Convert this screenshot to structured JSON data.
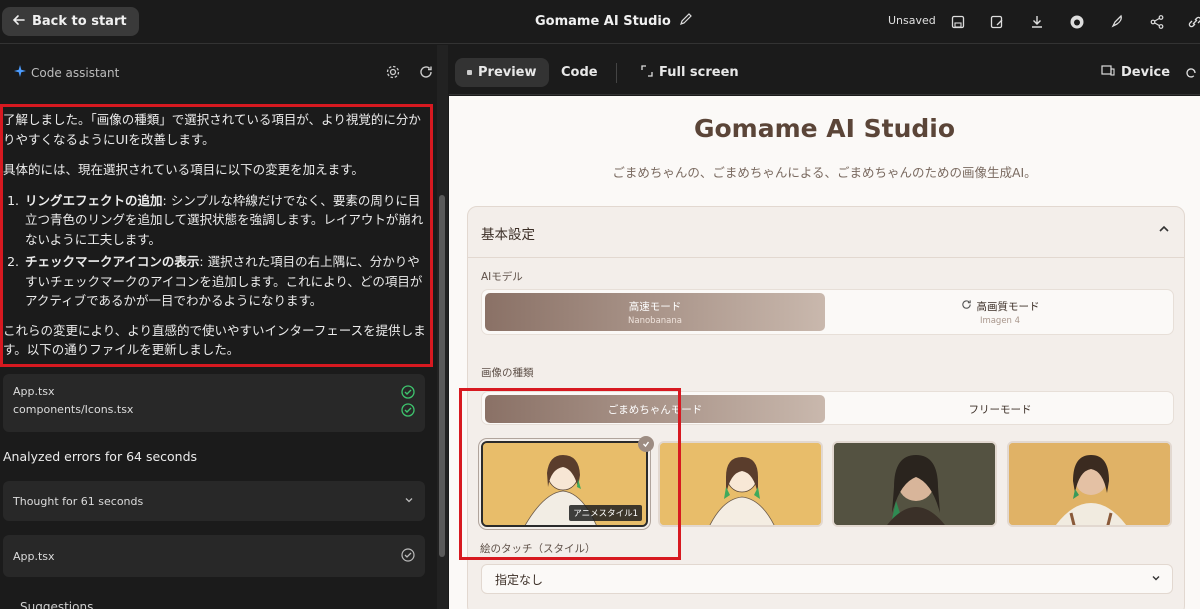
{
  "topbar": {
    "back_label": "Back to start",
    "app_title": "Gomame AI Studio",
    "status": "Unsaved"
  },
  "assistant": {
    "header": "Code assistant",
    "message": {
      "para1": "了解しました。「画像の種類」で選択されている項目が、より視覚的に分かりやすくなるようにUIを改善します。",
      "para2": "具体的には、現在選択されている項目に以下の変更を加えます。",
      "items": [
        {
          "title": "リングエフェクトの追加",
          "text": ": シンプルな枠線だけでなく、要素の周りに目立つ青色のリングを追加して選択状態を強調します。レイアウトが崩れないように工夫します。"
        },
        {
          "title": "チェックマークアイコンの表示",
          "text": ": 選択された項目の右上隅に、分かりやすいチェックマークのアイコンを追加します。これにより、どの項目がアクティブであるかが一目でわかるようになります。"
        }
      ],
      "para3": "これらの変更により、より直感的で使いやすいインターフェースを提供します。以下の通りファイルを更新しました。"
    },
    "files": [
      "App.tsx",
      "components/Icons.tsx"
    ],
    "analyzed": "Analyzed errors for 64 seconds",
    "thought": "Thought for 61 seconds",
    "app_file": "App.tsx",
    "suggestions": "Suggestions"
  },
  "preview_bar": {
    "preview_label": "Preview",
    "code_label": "Code",
    "fullscreen_label": "Full screen",
    "device_label": "Device"
  },
  "preview": {
    "title": "Gomame AI Studio",
    "subtitle": "ごまめちゃんの、ごまめちゃんによる、ごまめちゃんのための画像生成AI。",
    "card_title": "基本設定",
    "model_label": "AIモデル",
    "model_options": [
      {
        "label": "高速モード",
        "sub": "Nanobanana"
      },
      {
        "label": "高画質モード",
        "sub": "Imagen 4"
      }
    ],
    "type_label": "画像の種類",
    "type_options": [
      "ごまめちゃんモード",
      "フリーモード"
    ],
    "thumb_tag": "アニメスタイル1",
    "touch_label": "絵のタッチ（スタイル）",
    "touch_value": "指定なし"
  },
  "colors": {
    "highlight": "#d71920",
    "accent_brown": "#5b4538"
  }
}
